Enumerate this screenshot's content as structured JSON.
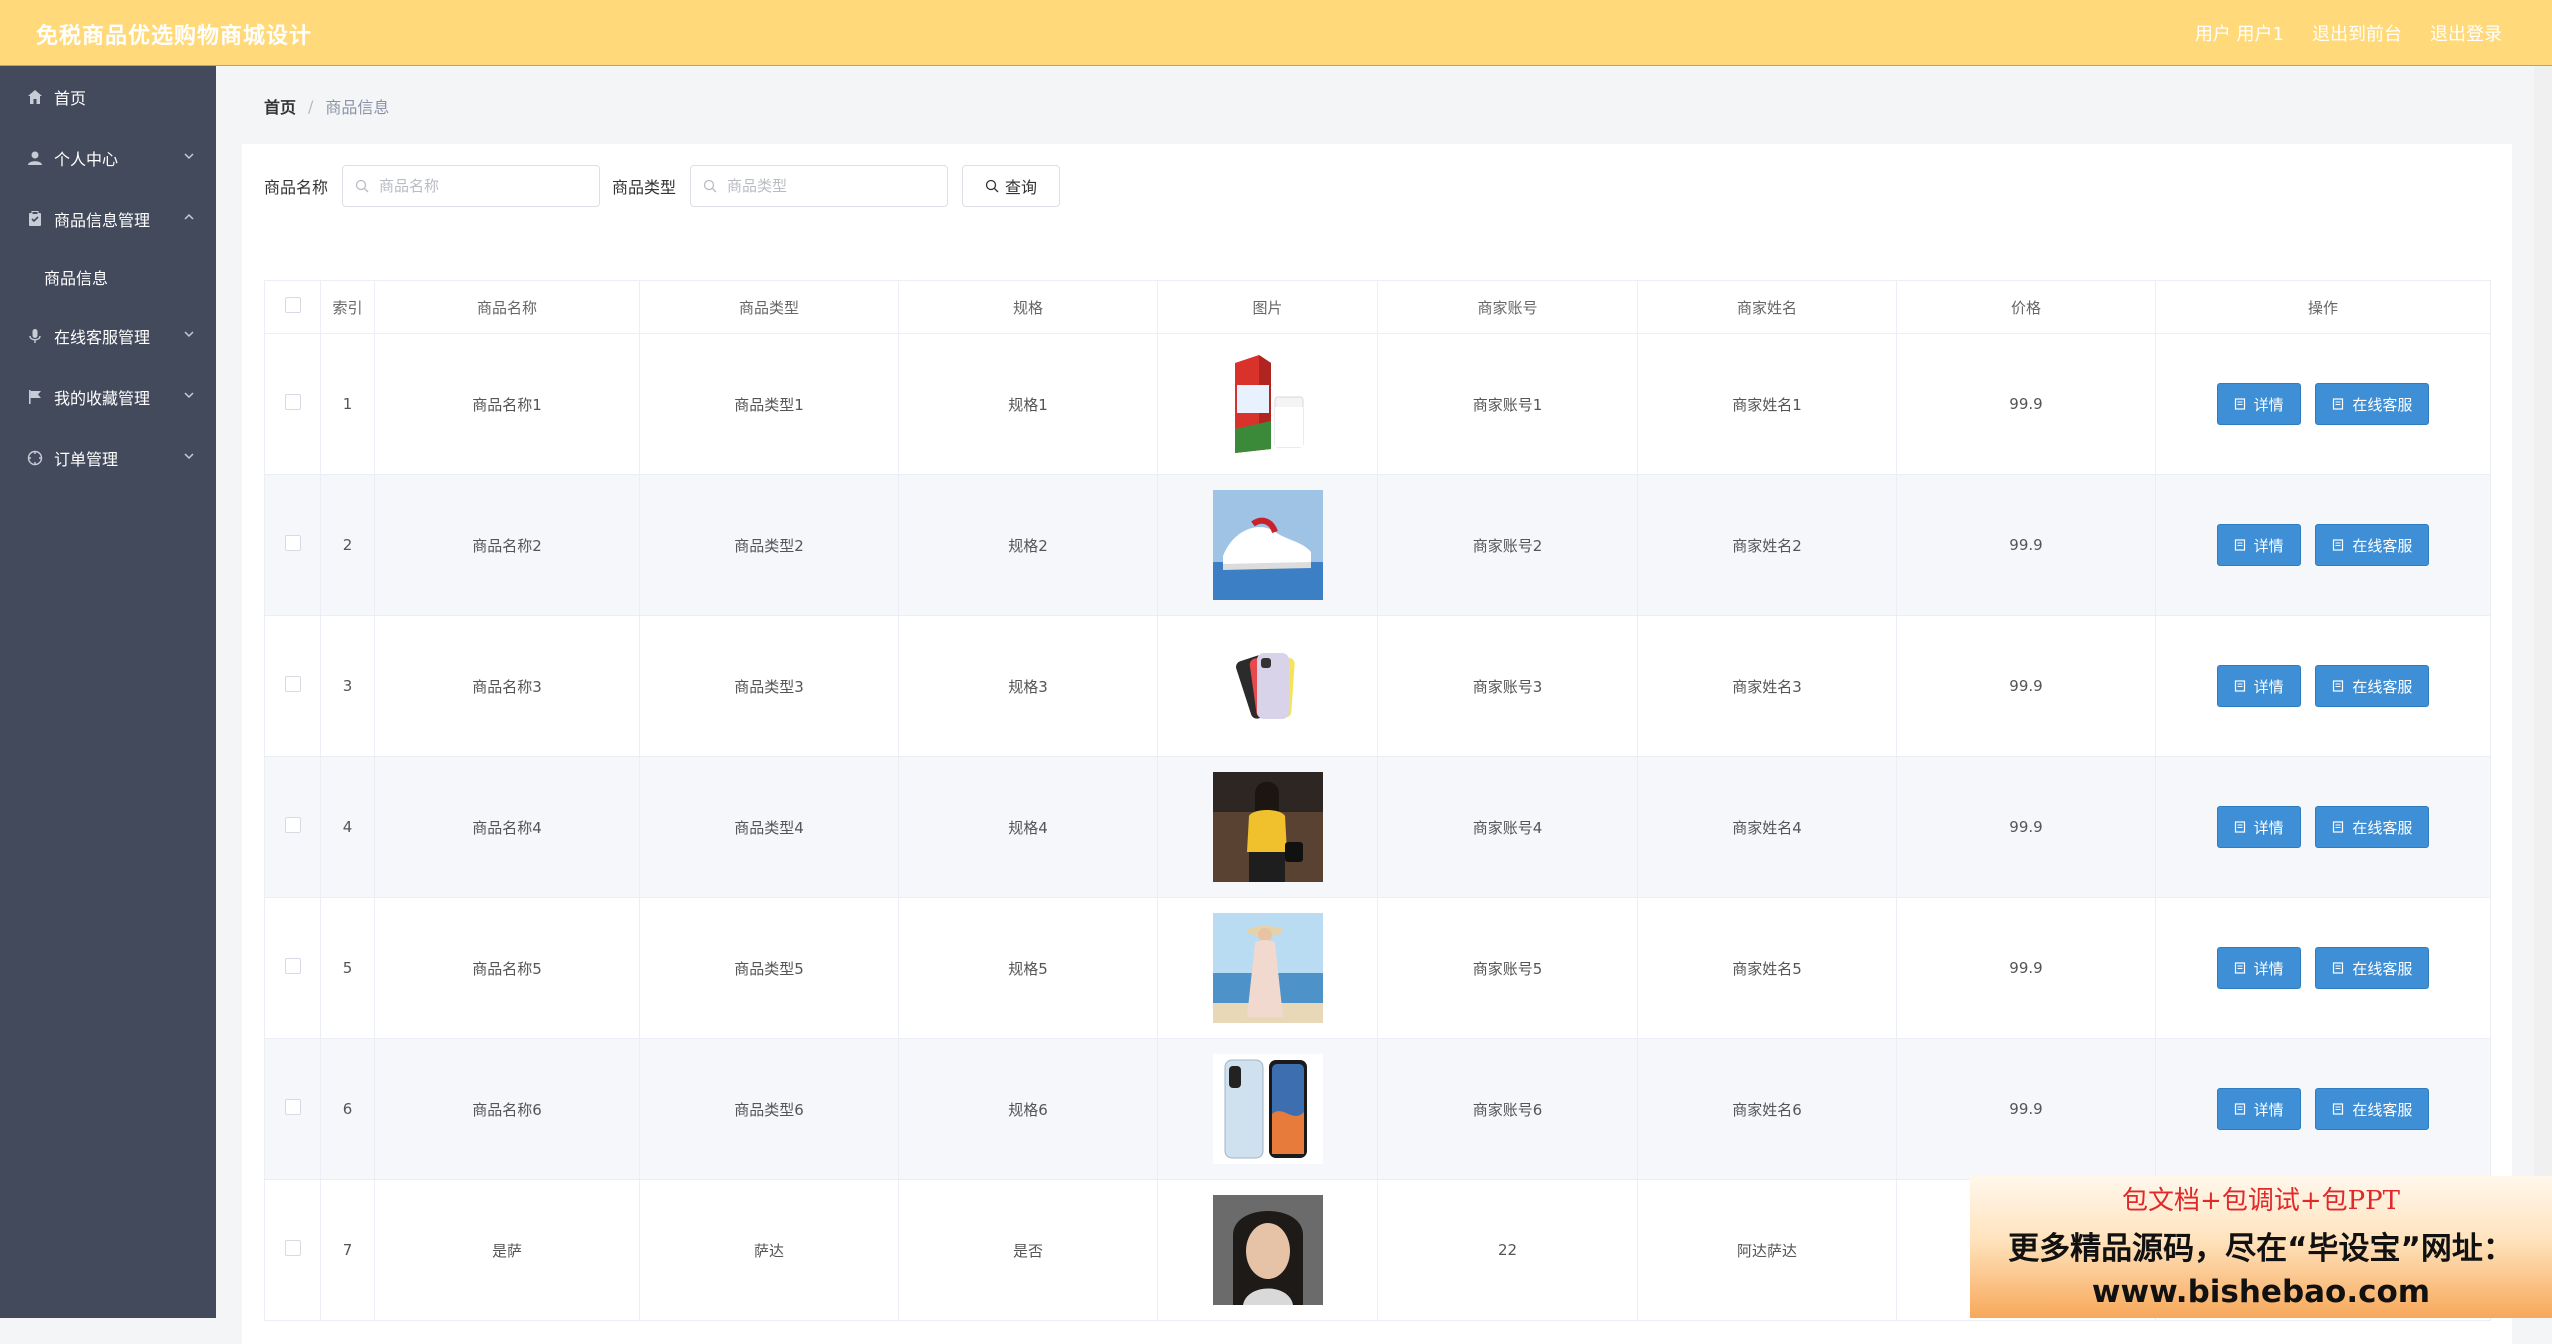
{
  "app": {
    "title": "免税商品优选购物商城设计",
    "user_label": "用户 用户1",
    "exit_console": "退出到前台",
    "logout": "退出登录"
  },
  "sidebar": {
    "items": [
      {
        "label": "首页"
      },
      {
        "label": "个人中心"
      },
      {
        "label": "商品信息管理"
      },
      {
        "label": "商品信息"
      },
      {
        "label": "在线客服管理"
      },
      {
        "label": "我的收藏管理"
      },
      {
        "label": "订单管理"
      }
    ]
  },
  "breadcrumb": {
    "home": "首页",
    "sep": "/",
    "current": "商品信息"
  },
  "filters": {
    "name_label": "商品名称",
    "name_placeholder": "商品名称",
    "type_label": "商品类型",
    "type_placeholder": "商品类型",
    "query_label": "查询"
  },
  "table": {
    "headers": [
      "索引",
      "商品名称",
      "商品类型",
      "规格",
      "图片",
      "商家账号",
      "商家姓名",
      "价格",
      "操作"
    ],
    "detail_label": "详情",
    "service_label": "在线客服",
    "rows": [
      {
        "index": "1",
        "name": "商品名称1",
        "type": "商品类型1",
        "spec": "规格1",
        "account": "商家账号1",
        "merchant": "商家姓名1",
        "price": "99.9",
        "image": "milk-carton"
      },
      {
        "index": "2",
        "name": "商品名称2",
        "type": "商品类型2",
        "spec": "规格2",
        "account": "商家账号2",
        "merchant": "商家姓名2",
        "price": "99.9",
        "image": "sneakers"
      },
      {
        "index": "3",
        "name": "商品名称3",
        "type": "商品类型3",
        "spec": "规格3",
        "account": "商家账号3",
        "merchant": "商家姓名3",
        "price": "99.9",
        "image": "smartphone-colors"
      },
      {
        "index": "4",
        "name": "商品名称4",
        "type": "商品类型4",
        "spec": "规格4",
        "account": "商家账号4",
        "merchant": "商家姓名4",
        "price": "99.9",
        "image": "woman-yellow-top"
      },
      {
        "index": "5",
        "name": "商品名称5",
        "type": "商品类型5",
        "spec": "规格5",
        "account": "商家账号5",
        "merchant": "商家姓名5",
        "price": "99.9",
        "image": "woman-beach-dress"
      },
      {
        "index": "6",
        "name": "商品名称6",
        "type": "商品类型6",
        "spec": "规格6",
        "account": "商家账号6",
        "merchant": "商家姓名6",
        "price": "99.9",
        "image": "smartphone-front"
      },
      {
        "index": "7",
        "name": "是萨",
        "type": "萨达",
        "spec": "是否",
        "account": "22",
        "merchant": "阿达萨达",
        "price": "",
        "image": "woman-portrait"
      }
    ]
  },
  "promo": {
    "line1": "包文档+包调试+包PPT",
    "line2": "更多精品源码，尽在“毕设宝”网址：",
    "line3": "www.bishebao.com"
  },
  "colors": {
    "topbar": "#ffd97a",
    "sidebar": "#434a5b",
    "button": "#3e8fd6"
  }
}
